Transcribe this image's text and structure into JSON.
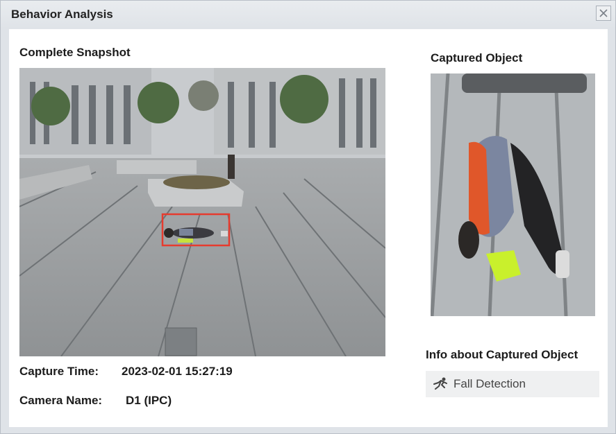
{
  "window": {
    "title": "Behavior Analysis"
  },
  "snapshot": {
    "heading": "Complete Snapshot"
  },
  "captured_object": {
    "heading": "Captured Object"
  },
  "info": {
    "heading": "Info about Captured Object",
    "behavior": "Fall Detection",
    "icon": "fall-person-icon"
  },
  "capture": {
    "time_label": "Capture Time:",
    "time_value": "2023-02-01 15:27:19",
    "camera_label": "Camera Name:",
    "camera_value": "D1 (IPC)"
  },
  "colors": {
    "detection_box": "#e63b2e",
    "title_bar": "#dfe3e8"
  }
}
